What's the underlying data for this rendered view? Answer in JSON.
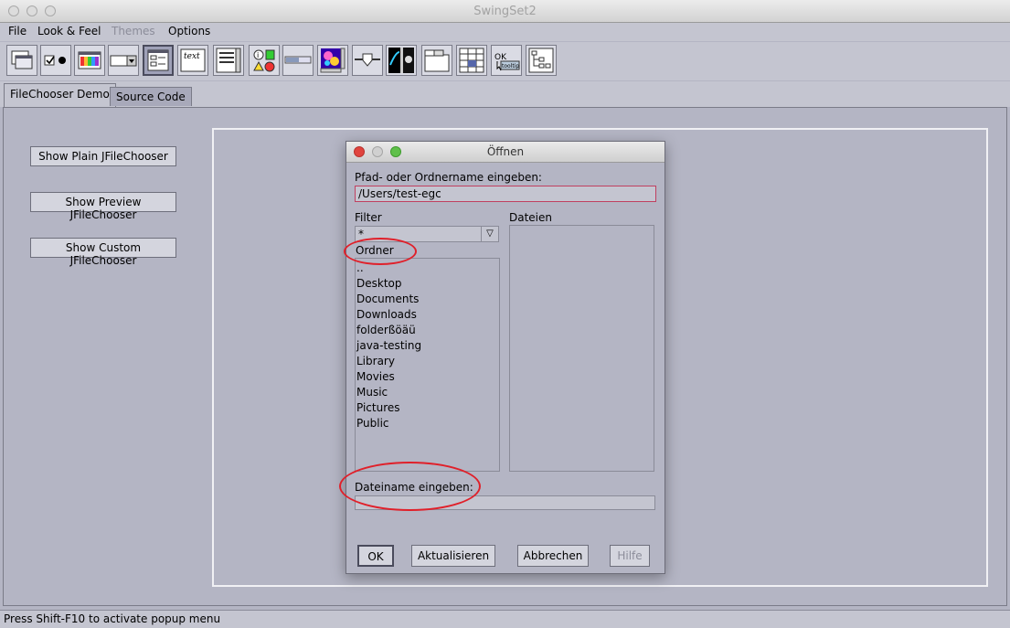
{
  "window": {
    "title": "SwingSet2"
  },
  "menu": {
    "items": [
      {
        "label": "File",
        "enabled": true
      },
      {
        "label": "Look & Feel",
        "enabled": true
      },
      {
        "label": "Themes",
        "enabled": false
      },
      {
        "label": "Options",
        "enabled": true
      }
    ]
  },
  "toolbar": {
    "icons": [
      "internalframe-icon",
      "buttons-icon",
      "colorchooser-icon",
      "combobox-icon",
      "filechooser-icon",
      "editorpane-icon",
      "list-icon",
      "optionpane-icon",
      "progressbar-icon",
      "scrollpane-icon",
      "slider-icon",
      "splitpane-icon",
      "tabbedpane-icon",
      "table-icon",
      "tooltip-icon",
      "tree-icon"
    ],
    "selected_index": 4,
    "text_icon_label": "text",
    "tooltip_ok_label": "OK",
    "tooltip_sub_label": "tooltip"
  },
  "tabs": [
    {
      "label": "FileChooser Demo",
      "selected": true
    },
    {
      "label": "Source Code",
      "selected": false
    }
  ],
  "demo_buttons": {
    "plain": "Show Plain JFileChooser",
    "preview": "Show Preview JFileChooser",
    "custom": "Show Custom JFileChooser"
  },
  "dialog": {
    "title": "Öffnen",
    "path_label": "Pfad- oder Ordnername eingeben:",
    "path_value": "/Users/test-egc",
    "filter_label": "Filter",
    "filter_value": "*",
    "files_label": "Dateien",
    "folders_label": "Ordner",
    "folders": [
      "..",
      "Desktop",
      "Documents",
      "Downloads",
      "folderßöäü",
      "java-testing",
      "Library",
      "Movies",
      "Music",
      "Pictures",
      "Public"
    ],
    "filename_label": "Dateiname eingeben:",
    "filename_value": "",
    "buttons": {
      "ok": "OK",
      "update": "Aktualisieren",
      "cancel": "Abbrechen",
      "help": "Hilfe"
    }
  },
  "status": {
    "text": "Press Shift-F10 to activate popup menu"
  },
  "colors": {
    "annotation": "#e0202a",
    "background": "#b4b5c4"
  }
}
